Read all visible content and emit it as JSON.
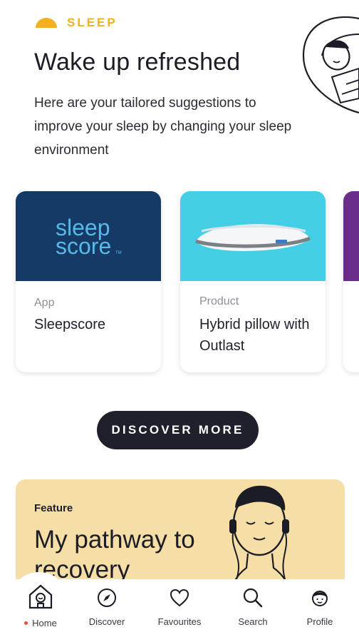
{
  "hero": {
    "category": "SLEEP",
    "title": "Wake up refreshed",
    "subtitle": "Here are your tailored suggestions to improve your sleep by changing your sleep environment",
    "accent_color": "#f2b11d"
  },
  "cards": [
    {
      "type": "App",
      "title": "Sleepscore",
      "logo_text": "sleep",
      "logo_text_2": "score",
      "logo_tm": "TM",
      "media_color": "#163a66"
    },
    {
      "type": "Product",
      "title": "Hybrid pillow with Outlast",
      "media_color": "#45cfe6"
    },
    {
      "type": "",
      "title": "",
      "media_color": "#6b2d8c"
    }
  ],
  "discover_button": "DISCOVER MORE",
  "feature": {
    "label": "Feature",
    "title": "My pathway to recovery",
    "background": "#f6dfa6"
  },
  "tabbar": {
    "items": [
      {
        "label": "Home",
        "icon": "home-icon",
        "active": true
      },
      {
        "label": "Discover",
        "icon": "compass-icon"
      },
      {
        "label": "Favourites",
        "icon": "heart-icon"
      },
      {
        "label": "Search",
        "icon": "search-icon"
      },
      {
        "label": "Profile",
        "icon": "profile-icon"
      }
    ],
    "active_dot_color": "#e0533d"
  }
}
